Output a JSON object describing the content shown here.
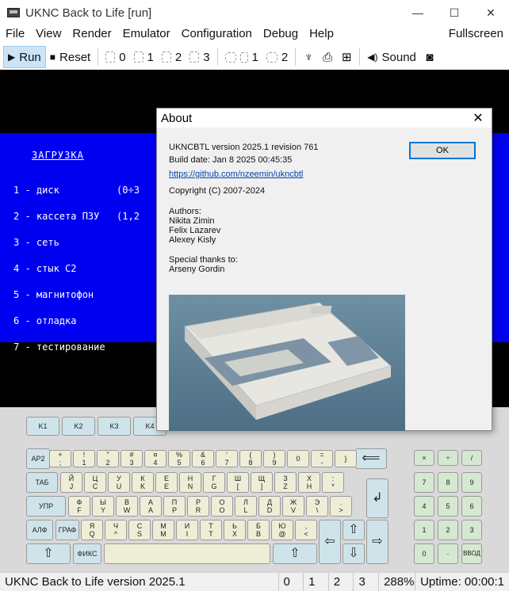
{
  "window": {
    "title": "UKNC Back to Life [run]",
    "controls": {
      "minimize": "—",
      "maximize": "☐",
      "close": "✕"
    }
  },
  "menubar": {
    "items": [
      "File",
      "View",
      "Render",
      "Emulator",
      "Configuration",
      "Debug",
      "Help"
    ],
    "right_item": "Fullscreen"
  },
  "toolbar": {
    "run_label": "Run",
    "reset_label": "Reset",
    "disk_labels": [
      "0",
      "1",
      "2",
      "3"
    ],
    "cart_labels": [
      "1",
      "2"
    ],
    "sound_label": "Sound",
    "icons": [
      "play-icon",
      "stop-icon",
      "joystick-icon",
      "printer-icon",
      "network-icon",
      "speaker-icon",
      "camera-icon"
    ]
  },
  "screen": {
    "heading": "ЗАГРУЗКА",
    "lines": [
      "1 - диск          (0÷3",
      "2 - кассета ПЗУ   (1,2",
      "3 - сеть",
      "4 - стык С2",
      "5 - магнитофон",
      "6 - отладка",
      "7 - тестирование"
    ]
  },
  "about": {
    "title": "About",
    "version": "UKNCBTL version 2025.1 revision 761",
    "build_date": "Build date: Jan  8 2025 00:45:35",
    "link": "https://github.com/nzeemin/ukncbtl",
    "copyright": "Copyright (C) 2007-2024",
    "authors_label": "Authors:",
    "authors": [
      "Nikita Zimin",
      "Felix Lazarev",
      "Alexey Kisly"
    ],
    "thanks_label": "Special thanks to:",
    "thanks": [
      "Arseny Gordin"
    ],
    "ok_label": "OK"
  },
  "keyboard": {
    "fkeys": [
      "K1",
      "K2",
      "K3",
      "K4"
    ],
    "row1": [
      [
        "+",
        ";"
      ],
      [
        "!",
        "1"
      ],
      [
        "\"",
        "2"
      ],
      [
        "#",
        "3"
      ],
      [
        "¤",
        "4"
      ],
      [
        "%",
        "5"
      ],
      [
        "&",
        "6"
      ],
      [
        "'",
        "7"
      ],
      [
        "(",
        "8"
      ],
      [
        ")",
        "9"
      ],
      [
        "",
        "0"
      ],
      [
        "=",
        "-"
      ],
      [
        "",
        "}"
      ]
    ],
    "row2": [
      [
        "Й",
        "J"
      ],
      [
        "Ц",
        "C"
      ],
      [
        "У",
        "U"
      ],
      [
        "К",
        "K"
      ],
      [
        "Е",
        "E"
      ],
      [
        "Н",
        "N"
      ],
      [
        "Г",
        "G"
      ],
      [
        "Ш",
        "["
      ],
      [
        "Щ",
        "]"
      ],
      [
        "З",
        "Z"
      ],
      [
        "Х",
        "H"
      ],
      [
        ":",
        "*"
      ]
    ],
    "row3": [
      [
        "Ф",
        "F"
      ],
      [
        "Ы",
        "Y"
      ],
      [
        "В",
        "W"
      ],
      [
        "А",
        "A"
      ],
      [
        "П",
        "P"
      ],
      [
        "Р",
        "R"
      ],
      [
        "О",
        "O"
      ],
      [
        "Л",
        "L"
      ],
      [
        "Д",
        "D"
      ],
      [
        "Ж",
        "V"
      ],
      [
        "Э",
        "\\"
      ],
      [
        ".",
        ">"
      ]
    ],
    "row4": [
      [
        "Я",
        "Q"
      ],
      [
        "Ч",
        "^"
      ],
      [
        "С",
        "S"
      ],
      [
        "М",
        "M"
      ],
      [
        "И",
        "I"
      ],
      [
        "Т",
        "T"
      ],
      [
        "Ь",
        "X"
      ],
      [
        "Б",
        "B"
      ],
      [
        "Ю",
        "@"
      ],
      [
        ",",
        "<"
      ]
    ],
    "left_keys": [
      "АР2",
      "ТАБ",
      "УПР",
      "АЛФ",
      "ГРАФ",
      "ФИКС"
    ],
    "numpad": {
      "top": [
        "×",
        "÷",
        "/"
      ],
      "rows": [
        [
          "7",
          "8",
          "9"
        ],
        [
          "4",
          "5",
          "6"
        ],
        [
          "1",
          "2",
          "3"
        ],
        [
          "0",
          "·",
          "ВВОД"
        ]
      ]
    }
  },
  "statusbar": {
    "text": "UKNC Back to Life version 2025.1",
    "cells": [
      "0",
      "1",
      "2",
      "3"
    ],
    "speed": "288%",
    "uptime": "Uptime: 00:00:1"
  }
}
